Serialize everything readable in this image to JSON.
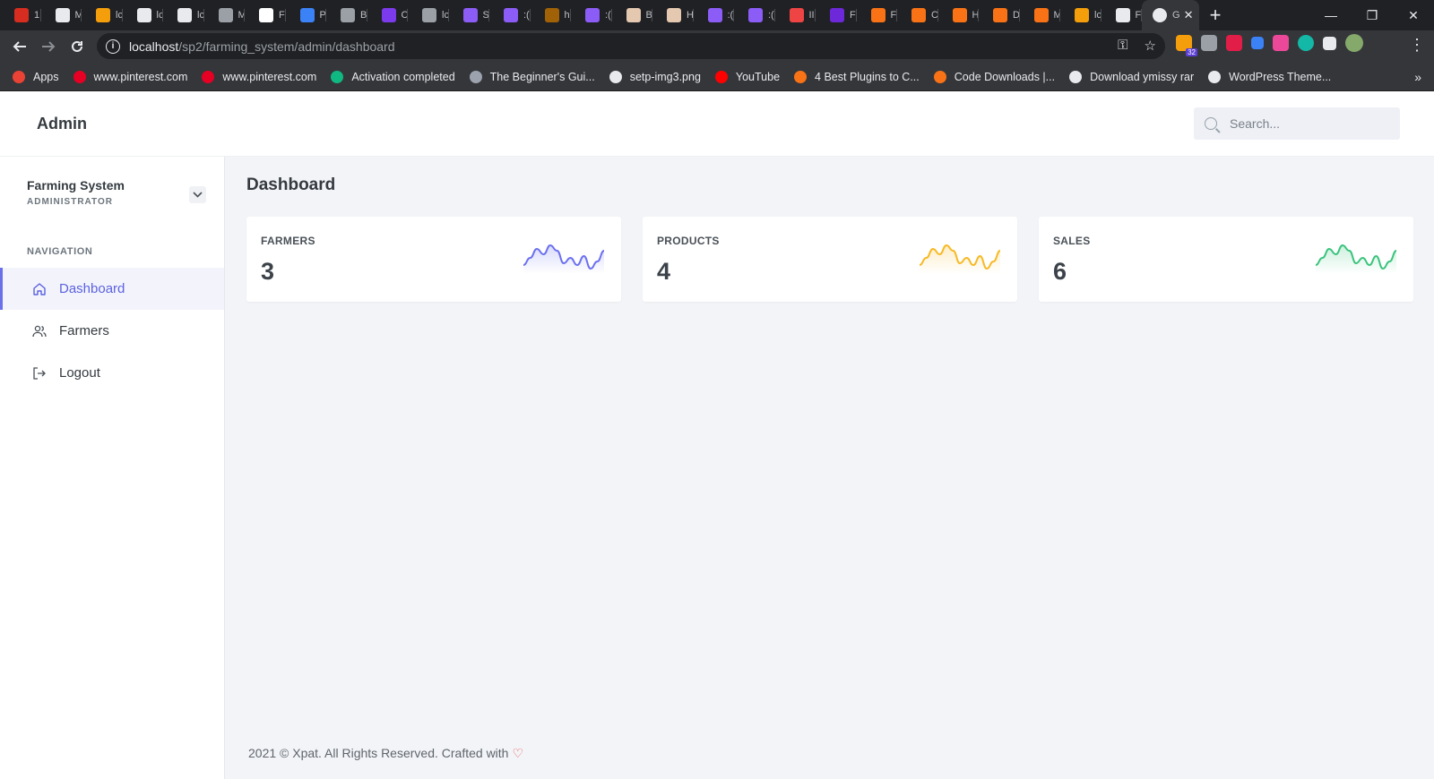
{
  "browser": {
    "tabs": [
      {
        "label": "1!",
        "color": "#d62d20"
      },
      {
        "label": "M",
        "color": "#e8eaed"
      },
      {
        "label": "lc",
        "color": "#f59e0b"
      },
      {
        "label": "lc",
        "color": "#e8eaed"
      },
      {
        "label": "lc",
        "color": "#e8eaed"
      },
      {
        "label": "M",
        "color": "#9aa0a6"
      },
      {
        "label": "F",
        "color": "#ffffff"
      },
      {
        "label": "P",
        "color": "#3b82f6"
      },
      {
        "label": "B",
        "color": "#9aa0a6"
      },
      {
        "label": "C",
        "color": "#7c3aed"
      },
      {
        "label": "lc",
        "color": "#9aa0a6"
      },
      {
        "label": "S",
        "color": "#8b5cf6"
      },
      {
        "label": ":(",
        "color": "#8b5cf6"
      },
      {
        "label": "h",
        "color": "#a16207"
      },
      {
        "label": ":(",
        "color": "#8b5cf6"
      },
      {
        "label": "B",
        "color": "#e5c8b0"
      },
      {
        "label": "H",
        "color": "#e5c8b0"
      },
      {
        "label": ":(",
        "color": "#8b5cf6"
      },
      {
        "label": ":(",
        "color": "#8b5cf6"
      },
      {
        "label": "II",
        "color": "#ef4444"
      },
      {
        "label": "F",
        "color": "#6d28d9"
      },
      {
        "label": "F",
        "color": "#f97316"
      },
      {
        "label": "C",
        "color": "#f97316"
      },
      {
        "label": "H",
        "color": "#f97316"
      },
      {
        "label": "D",
        "color": "#f97316"
      },
      {
        "label": "M",
        "color": "#f97316"
      },
      {
        "label": "lc",
        "color": "#f59e0b"
      },
      {
        "label": "F",
        "color": "#e8eaed"
      }
    ],
    "active_tab": {
      "label": "G",
      "close": "✕"
    },
    "new_tab": "+",
    "window_controls": {
      "minimize": "—",
      "restore": "❐",
      "close": "✕"
    },
    "url": {
      "host": "localhost",
      "path": "/sp2/farming_system/admin/dashboard"
    },
    "extension_badge": "32",
    "bookmarks": [
      {
        "label": "Apps",
        "color": "#ea4335"
      },
      {
        "label": "www.pinterest.com",
        "color": "#e60023"
      },
      {
        "label": "www.pinterest.com",
        "color": "#e60023"
      },
      {
        "label": "Activation completed",
        "color": "#10b981"
      },
      {
        "label": "The Beginner's Gui...",
        "color": "#9ca3af"
      },
      {
        "label": "setp-img3.png",
        "color": "#e8eaed"
      },
      {
        "label": "YouTube",
        "color": "#ff0000"
      },
      {
        "label": "4 Best Plugins to C...",
        "color": "#f97316"
      },
      {
        "label": "Code Downloads |...",
        "color": "#f97316"
      },
      {
        "label": "Download ymissy rar",
        "color": "#e8eaed"
      },
      {
        "label": "WordPress Theme...",
        "color": "#e8eaed"
      }
    ],
    "bookmarks_overflow": "»"
  },
  "header": {
    "brand": "Admin",
    "search_placeholder": "Search..."
  },
  "sidebar": {
    "org_name": "Farming System",
    "org_role": "ADMINISTRATOR",
    "nav_heading": "NAVIGATION",
    "items": [
      {
        "label": "Dashboard",
        "icon": "home-icon",
        "active": true
      },
      {
        "label": "Farmers",
        "icon": "users-icon",
        "active": false
      },
      {
        "label": "Logout",
        "icon": "logout-icon",
        "active": false
      }
    ]
  },
  "main": {
    "title": "Dashboard",
    "cards": [
      {
        "label": "FARMERS",
        "value": "3",
        "color": "#6b70f0"
      },
      {
        "label": "PRODUCTS",
        "value": "4",
        "color": "#f7b924"
      },
      {
        "label": "SALES",
        "value": "6",
        "color": "#3ac47d"
      }
    ]
  },
  "footer": {
    "text": "2021 © Xpat. All Rights Reserved. Crafted with",
    "heart": "♡"
  }
}
